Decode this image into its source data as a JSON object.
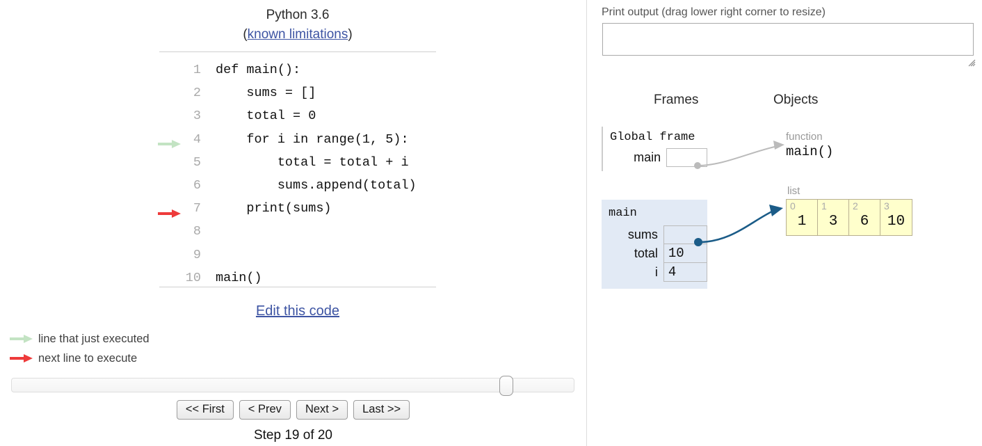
{
  "code_panel": {
    "version_title": "Python 3.6",
    "limitations_prefix": "(",
    "limitations_link": "known limitations",
    "limitations_suffix": ")",
    "lines": [
      {
        "number": "1",
        "text": "def main():",
        "arrow": "none"
      },
      {
        "number": "2",
        "text": "    sums = []",
        "arrow": "none"
      },
      {
        "number": "3",
        "text": "    total = 0",
        "arrow": "none"
      },
      {
        "number": "4",
        "text": "    for i in range(1, 5):",
        "arrow": "green"
      },
      {
        "number": "5",
        "text": "        total = total + i",
        "arrow": "none"
      },
      {
        "number": "6",
        "text": "        sums.append(total)",
        "arrow": "none"
      },
      {
        "number": "7",
        "text": "    print(sums)",
        "arrow": "red"
      },
      {
        "number": "8",
        "text": "",
        "arrow": "none"
      },
      {
        "number": "9",
        "text": "",
        "arrow": "none"
      },
      {
        "number": "10",
        "text": "main()",
        "arrow": "none"
      }
    ],
    "edit_link": "Edit this code"
  },
  "legend": {
    "just_executed": "line that just executed",
    "next_to_execute": "next line to execute",
    "green_color": "#c3e3c3",
    "red_color": "#ee3b3b"
  },
  "navigation": {
    "first_label": "<< First",
    "prev_label": "< Prev",
    "next_label": "Next >",
    "last_label": "Last >>",
    "step_text": "Step 19 of 20",
    "slider_position_percent": 89
  },
  "output_panel": {
    "print_output_label": "Print output (drag lower right corner to resize)",
    "print_output_value": ""
  },
  "visualization": {
    "frames_heading": "Frames",
    "objects_heading": "Objects",
    "frames": [
      {
        "title": "Global frame",
        "highlighted": false,
        "variables": [
          {
            "name": "main",
            "value": "",
            "is_pointer": true
          }
        ]
      },
      {
        "title": "main",
        "highlighted": true,
        "variables": [
          {
            "name": "sums",
            "value": "",
            "is_pointer": true
          },
          {
            "name": "total",
            "value": "10",
            "is_pointer": false
          },
          {
            "name": "i",
            "value": "4",
            "is_pointer": false
          }
        ]
      }
    ],
    "objects": [
      {
        "kind": "function",
        "type_label": "function",
        "name": "main()"
      },
      {
        "kind": "list",
        "type_label": "list",
        "cells": [
          {
            "index": "0",
            "value": "1"
          },
          {
            "index": "1",
            "value": "3"
          },
          {
            "index": "2",
            "value": "6"
          },
          {
            "index": "3",
            "value": "10"
          }
        ]
      }
    ],
    "colors": {
      "frame_highlight": "#e2eaf5",
      "list_cell": "#ffffcc",
      "pointer_arrow": "#1b5c88",
      "function_arrow": "#bbbbbb"
    }
  }
}
